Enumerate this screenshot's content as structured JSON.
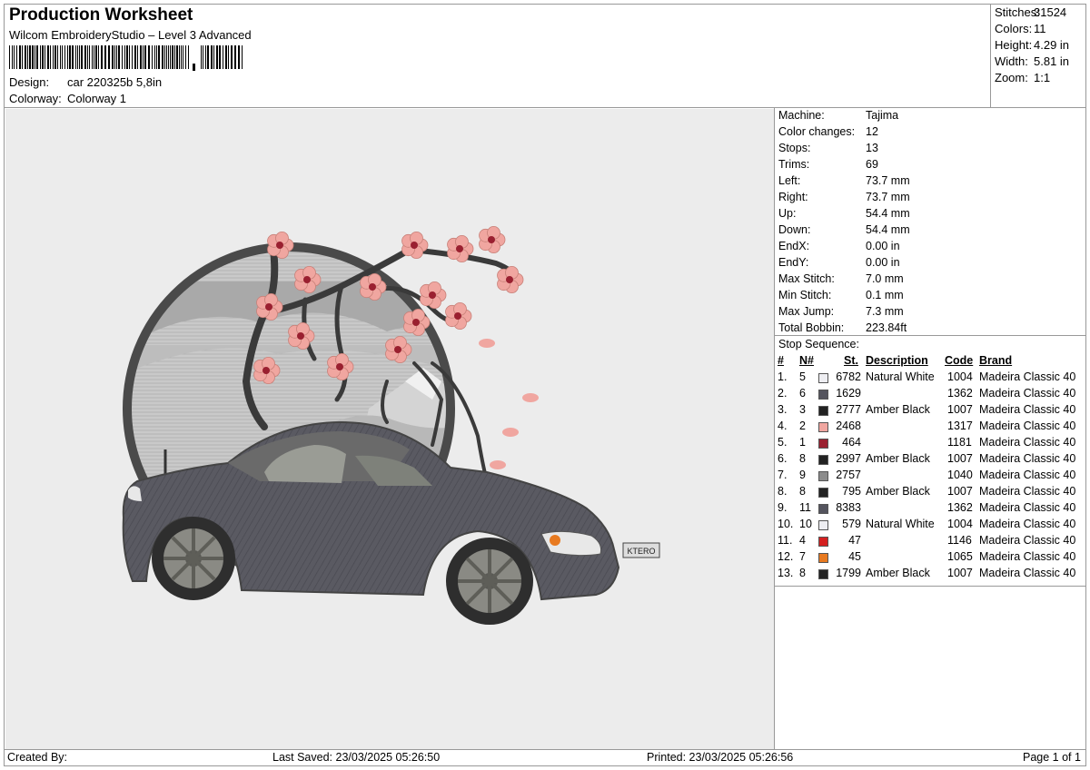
{
  "header": {
    "title": "Production Worksheet",
    "subtitle": "Wilcom EmbroideryStudio – Level 3 Advanced",
    "design_label": "Design:",
    "design_value": "car 220325b 5,8in",
    "colorway_label": "Colorway:",
    "colorway_value": "Colorway 1"
  },
  "stats": [
    {
      "label": "Stitches:",
      "value": "31524"
    },
    {
      "label": "Colors:",
      "value": "11"
    },
    {
      "label": "Height:",
      "value": "4.29 in"
    },
    {
      "label": "Width:",
      "value": "5.81 in"
    },
    {
      "label": "Zoom:",
      "value": "1:1"
    }
  ],
  "machine_info": [
    {
      "label": "Machine:",
      "value": "Tajima"
    },
    {
      "label": "Color changes:",
      "value": "12"
    },
    {
      "label": "Stops:",
      "value": "13"
    },
    {
      "label": "Trims:",
      "value": "69"
    },
    {
      "label": "Left:",
      "value": "73.7 mm"
    },
    {
      "label": "Right:",
      "value": "73.7 mm"
    },
    {
      "label": "Up:",
      "value": "54.4 mm"
    },
    {
      "label": "Down:",
      "value": "54.4 mm"
    },
    {
      "label": "EndX:",
      "value": "0.00 in"
    },
    {
      "label": "EndY:",
      "value": "0.00 in"
    },
    {
      "label": "Max Stitch:",
      "value": "7.0 mm"
    },
    {
      "label": "Min Stitch:",
      "value": "0.1 mm"
    },
    {
      "label": "Max Jump:",
      "value": "7.3 mm"
    },
    {
      "label": "Total Bobbin:",
      "value": "223.84ft"
    }
  ],
  "stop_sequence": {
    "title": "Stop Sequence:",
    "headers": {
      "num": "#",
      "n": "N#",
      "st": "St.",
      "description": "Description",
      "code": "Code",
      "brand": "Brand"
    },
    "rows": [
      {
        "num": "1.",
        "n": "5",
        "color": "#eeeef2",
        "st": "6782",
        "description": "Natural White",
        "code": "1004",
        "brand": "Madeira Classic 40"
      },
      {
        "num": "2.",
        "n": "6",
        "color": "#54545e",
        "st": "1629",
        "description": "",
        "code": "1362",
        "brand": "Madeira Classic 40"
      },
      {
        "num": "3.",
        "n": "3",
        "color": "#222222",
        "st": "2777",
        "description": "Amber Black",
        "code": "1007",
        "brand": "Madeira Classic 40"
      },
      {
        "num": "4.",
        "n": "2",
        "color": "#f0a6a0",
        "st": "2468",
        "description": "",
        "code": "1317",
        "brand": "Madeira Classic 40"
      },
      {
        "num": "5.",
        "n": "1",
        "color": "#9a2030",
        "st": "464",
        "description": "",
        "code": "1181",
        "brand": "Madeira Classic 40"
      },
      {
        "num": "6.",
        "n": "8",
        "color": "#222222",
        "st": "2997",
        "description": "Amber Black",
        "code": "1007",
        "brand": "Madeira Classic 40"
      },
      {
        "num": "7.",
        "n": "9",
        "color": "#8c8c8c",
        "st": "2757",
        "description": "",
        "code": "1040",
        "brand": "Madeira Classic 40"
      },
      {
        "num": "8.",
        "n": "8",
        "color": "#222222",
        "st": "795",
        "description": "Amber Black",
        "code": "1007",
        "brand": "Madeira Classic 40"
      },
      {
        "num": "9.",
        "n": "11",
        "color": "#54545e",
        "st": "8383",
        "description": "",
        "code": "1362",
        "brand": "Madeira Classic 40"
      },
      {
        "num": "10.",
        "n": "10",
        "color": "#eeeef2",
        "st": "579",
        "description": "Natural White",
        "code": "1004",
        "brand": "Madeira Classic 40"
      },
      {
        "num": "11.",
        "n": "4",
        "color": "#d42020",
        "st": "47",
        "description": "",
        "code": "1146",
        "brand": "Madeira Classic 40"
      },
      {
        "num": "12.",
        "n": "7",
        "color": "#e87a20",
        "st": "45",
        "description": "",
        "code": "1065",
        "brand": "Madeira Classic 40"
      },
      {
        "num": "13.",
        "n": "8",
        "color": "#222222",
        "st": "1799",
        "description": "Amber Black",
        "code": "1007",
        "brand": "Madeira Classic 40"
      }
    ]
  },
  "footer": {
    "created_by": "Created By:",
    "last_saved": "Last Saved: 23/03/2025 05:26:50",
    "printed": "Printed: 23/03/2025 05:26:56",
    "page": "Page 1 of 1"
  },
  "car_plate_text": "KTERO"
}
